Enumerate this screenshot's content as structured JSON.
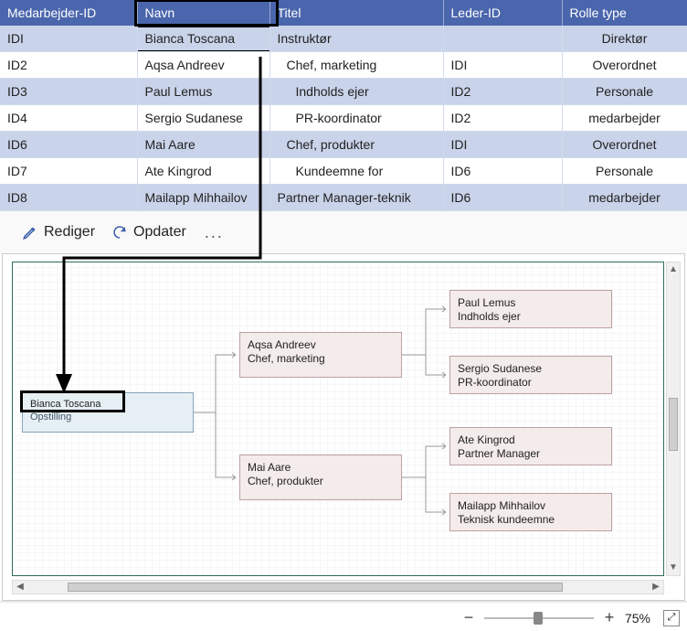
{
  "table": {
    "headers": {
      "emp_id": "Medarbejder-ID",
      "name": "Navn",
      "title": "Titel",
      "mgr_id": "Leder-ID",
      "role_type": "Rolle type"
    },
    "rows": [
      {
        "emp_id": "IDI",
        "name": "Bianca Toscana",
        "title": "Instruktør",
        "mgr_id": "",
        "role_type": "Direktør"
      },
      {
        "emp_id": "ID2",
        "name": "Aqsa Andreev",
        "title": "Chef, marketing",
        "mgr_id": "IDI",
        "role_type": "Overordnet"
      },
      {
        "emp_id": "ID3",
        "name": "Paul Lemus",
        "title": "Indholds ejer",
        "mgr_id": "ID2",
        "role_type": "Personale"
      },
      {
        "emp_id": "ID4",
        "name": "Sergio Sudanese",
        "title": "PR-koordinator",
        "mgr_id": "ID2",
        "role_type": "medarbejder"
      },
      {
        "emp_id": "ID6",
        "name": "Mai Aare",
        "title": "Chef, produkter",
        "mgr_id": "IDI",
        "role_type": "Overordnet"
      },
      {
        "emp_id": "ID7",
        "name": "Ate Kingrod",
        "title": "Kundeemne for",
        "mgr_id": "ID6",
        "role_type": "Personale"
      },
      {
        "emp_id": "ID8",
        "name": "Mailapp Mihhailov",
        "title": "Partner Manager-teknik",
        "mgr_id": "ID6",
        "role_type": "medarbejder"
      }
    ]
  },
  "toolbar": {
    "edit": "Rediger",
    "refresh": "Opdater",
    "more": "..."
  },
  "diagram": {
    "root": {
      "name": "Bianca Toscana",
      "sub": "Opstilling"
    },
    "mgrs": [
      {
        "name": "Aqsa Andreev",
        "sub": "Chef, marketing"
      },
      {
        "name": "Mai Aare",
        "sub": "Chef, produkter"
      }
    ],
    "leaves": [
      {
        "name": "Paul Lemus",
        "sub": "Indholds ejer"
      },
      {
        "name": "Sergio Sudanese",
        "sub": "PR-koordinator"
      },
      {
        "name": "Ate Kingrod",
        "sub": "Partner Manager"
      },
      {
        "name": "Mailapp Mihhailov",
        "sub": "Teknisk kundeemne"
      }
    ]
  },
  "status": {
    "zoom": "75%"
  }
}
